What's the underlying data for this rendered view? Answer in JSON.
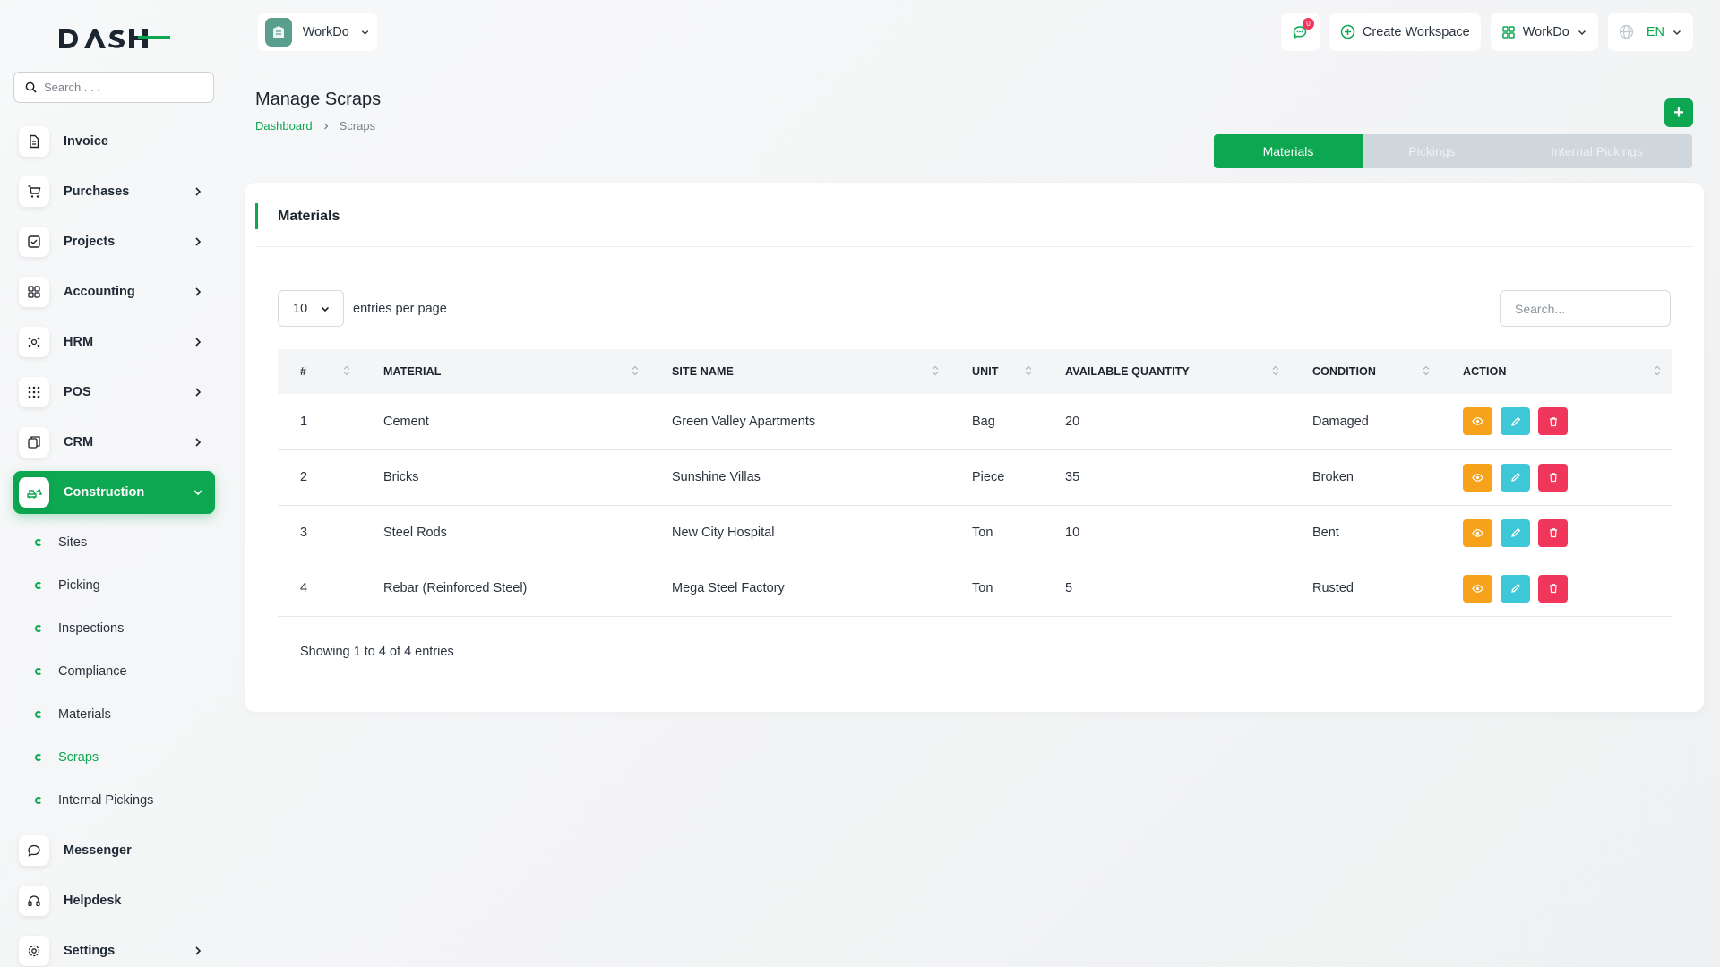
{
  "brand": {
    "logo_text": "DASH"
  },
  "sidebar": {
    "search_placeholder": "Search . . .",
    "items": [
      {
        "label": "Invoice",
        "icon": "file-icon",
        "chevron": false
      },
      {
        "label": "Purchases",
        "icon": "cart-icon",
        "chevron": true
      },
      {
        "label": "Projects",
        "icon": "checkbox-icon",
        "chevron": true
      },
      {
        "label": "Accounting",
        "icon": "grid-icon",
        "chevron": true
      },
      {
        "label": "HRM",
        "icon": "users-icon",
        "chevron": true
      },
      {
        "label": "POS",
        "icon": "dots-grid-icon",
        "chevron": true
      },
      {
        "label": "CRM",
        "icon": "layers-icon",
        "chevron": true
      },
      {
        "label": "Construction",
        "icon": "bulldozer-icon",
        "chevron": true,
        "active": true
      }
    ],
    "construction_sub": [
      "Sites",
      "Picking",
      "Inspections",
      "Compliance",
      "Materials",
      "Scraps",
      "Internal Pickings"
    ],
    "bottom_items": [
      {
        "label": "Messenger",
        "icon": "chat-icon",
        "chevron": false
      },
      {
        "label": "Helpdesk",
        "icon": "headset-icon",
        "chevron": false
      },
      {
        "label": "Settings",
        "icon": "gear-icon",
        "chevron": true
      }
    ]
  },
  "topbar": {
    "workspace": "WorkDo",
    "notification_count": "0",
    "create_workspace": "Create Workspace",
    "workspace_menu": "WorkDo",
    "language": "EN"
  },
  "page": {
    "title": "Manage Scraps",
    "breadcrumb": {
      "home": "Dashboard",
      "current": "Scraps"
    },
    "add_label": "+",
    "tabs": [
      "Materials",
      "Pickings",
      "Internal Pickings"
    ]
  },
  "card": {
    "title": "Materials",
    "entries_value": "10",
    "entries_label": "entries per page",
    "search_placeholder": "Search...",
    "columns": [
      "#",
      "MATERIAL",
      "SITE NAME",
      "UNIT",
      "AVAILABLE QUANTITY",
      "CONDITION",
      "ACTION"
    ],
    "rows": [
      {
        "no": "1",
        "material": "Cement",
        "site": "Green Valley Apartments",
        "unit": "Bag",
        "qty": "20",
        "condition": "Damaged"
      },
      {
        "no": "2",
        "material": "Bricks",
        "site": "Sunshine Villas",
        "unit": "Piece",
        "qty": "35",
        "condition": "Broken"
      },
      {
        "no": "3",
        "material": "Steel Rods",
        "site": "New City Hospital",
        "unit": "Ton",
        "qty": "10",
        "condition": "Bent"
      },
      {
        "no": "4",
        "material": "Rebar (Reinforced Steel)",
        "site": "Mega Steel Factory",
        "unit": "Ton",
        "qty": "5",
        "condition": "Rusted"
      }
    ],
    "footer": "Showing 1 to 4 of 4 entries"
  },
  "colors": {
    "accent": "#0ca750",
    "view": "#f7a21b",
    "edit": "#3ec8d7",
    "delete": "#f0365a"
  }
}
